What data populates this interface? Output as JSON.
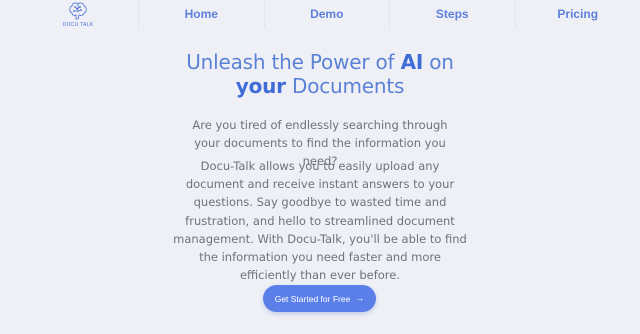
{
  "brand": {
    "name": "DOCU TALK",
    "logo_icon": "brain-icon"
  },
  "nav": {
    "items": [
      {
        "label": "Home"
      },
      {
        "label": "Demo"
      },
      {
        "label": "Steps"
      },
      {
        "label": "Pricing"
      }
    ]
  },
  "hero": {
    "title_part1": "Unleash the Power of ",
    "title_ai": "AI",
    "title_part2": " on",
    "title_your": "your",
    "title_part3": " Documents",
    "question": "Are you tired of endlessly searching through your documents to find the information you need?",
    "description": "Docu-Talk allows you to easily upload any document and receive instant answers to your questions. Say goodbye to wasted time and frustration, and hello to streamlined document management. With Docu-Talk, you'll be able to find the information you need faster and more efficiently than ever before.",
    "cta_label": "Get Started for Free",
    "cta_icon": "arrow-right-icon"
  },
  "colors": {
    "background": "#eef0f6",
    "accent": "#5b7fe9",
    "nav_text": "#5f7fdb",
    "body_text": "#6e727c"
  }
}
